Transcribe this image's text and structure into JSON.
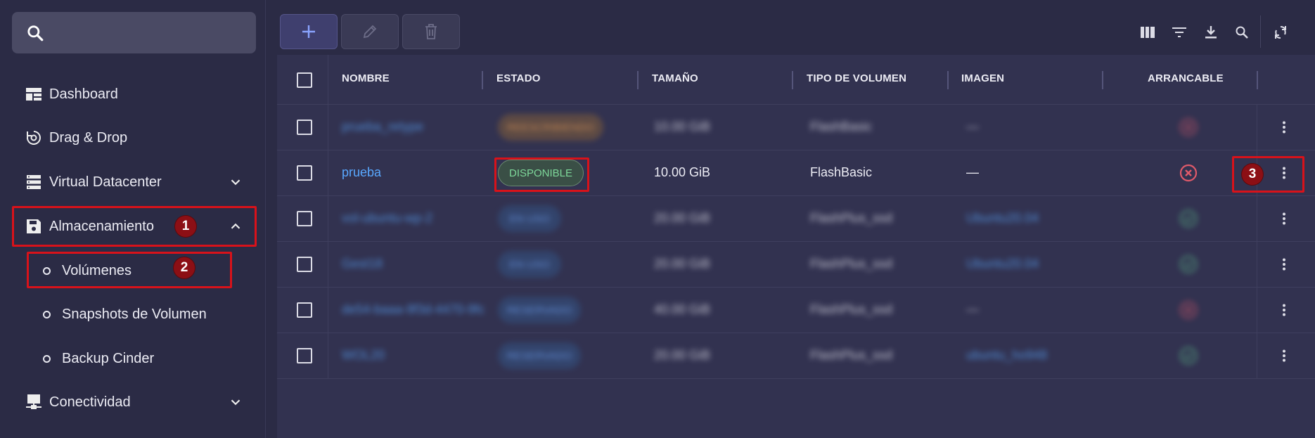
{
  "sidebar": {
    "search": {
      "placeholder": ""
    },
    "items": [
      {
        "label": "Dashboard",
        "icon": "dashboard-icon"
      },
      {
        "label": "Drag & Drop",
        "icon": "drag-drop-icon"
      },
      {
        "label": "Virtual Datacenter",
        "icon": "server-icon"
      },
      {
        "label": "Almacenamiento",
        "icon": "save-icon"
      },
      {
        "label": "Conectividad",
        "icon": "network-icon"
      }
    ],
    "subitems": [
      {
        "label": "Volúmenes"
      },
      {
        "label": "Snapshots de Volumen"
      },
      {
        "label": "Backup Cinder"
      }
    ]
  },
  "annotations": [
    "1",
    "2",
    "3"
  ],
  "toolbar": {
    "add_icon": "plus-icon",
    "edit_icon": "pencil-icon",
    "delete_icon": "trash-icon",
    "right_icons": [
      "columns-icon",
      "filter-icon",
      "download-icon",
      "search-icon",
      "refresh-icon"
    ]
  },
  "table": {
    "headers": [
      "NOMBRE",
      "ESTADO",
      "TAMAÑO",
      "TIPO DE VOLUMEN",
      "IMAGEN",
      "ARRANCABLE"
    ],
    "rows": [
      {
        "name": "prueba_retype",
        "status": "REESCRIBIENDO",
        "status_color": "orange",
        "size": "10.00 GiB",
        "type": "FlashBasic",
        "image": "—",
        "bootable": false,
        "blurred": true
      },
      {
        "name": "prueba",
        "status": "DISPONIBLE",
        "status_color": "green",
        "size": "10.00 GiB",
        "type": "FlashBasic",
        "image": "—",
        "bootable": false,
        "blurred": false
      },
      {
        "name": "vol-ubuntu-wp-2",
        "status": "EN USO",
        "status_color": "blue",
        "size": "20.00 GiB",
        "type": "FlashPlus_ssd",
        "image": "Ubuntu20.04",
        "bootable": true,
        "blurred": true
      },
      {
        "name": "Gest18",
        "status": "EN USO",
        "status_color": "blue",
        "size": "20.00 GiB",
        "type": "FlashPlus_ssd",
        "image": "Ubuntu20.04",
        "bootable": true,
        "blurred": true
      },
      {
        "name": "de54-baaa-9f3d-4470-9fc",
        "status": "RESERVADO",
        "status_color": "blue",
        "size": "40.00 GiB",
        "type": "FlashPlus_ssd",
        "image": "—",
        "bootable": false,
        "blurred": true
      },
      {
        "name": "WOL20",
        "status": "RESERVADO",
        "status_color": "blue",
        "size": "20.00 GiB",
        "type": "FlashPlus_ssd",
        "image": "ubuntu_ho948",
        "bootable": true,
        "blurred": true
      }
    ]
  },
  "colors": {
    "accent": "#59a8ff",
    "highlight": "#d8121a",
    "bad": "#e05a6a",
    "good": "#5ec48a"
  }
}
